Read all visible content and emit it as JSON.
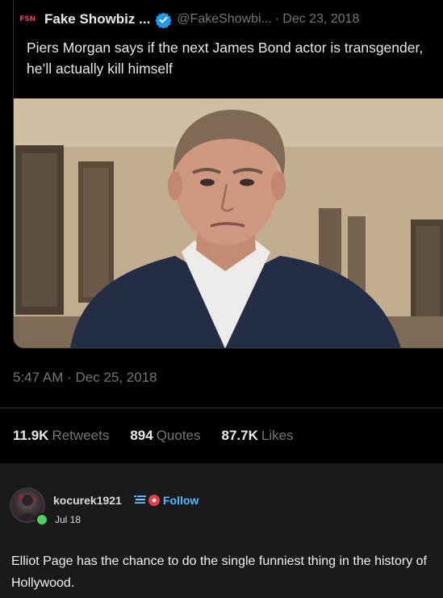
{
  "quoted_tweet": {
    "source_logo": "FSN",
    "author_name": "Fake Showbiz ...",
    "verified_icon": "verified-badge-icon",
    "handle": "@FakeShowbi...",
    "separator": "·",
    "date": "Dec 23, 2018",
    "text": "Piers Morgan says if the next James Bond actor is transgender, he’ll actually kill himself"
  },
  "tweet": {
    "timestamp": "5:47 AM · Dec 25, 2018",
    "stats": [
      {
        "value": "11.9K",
        "label": "Retweets"
      },
      {
        "value": "894",
        "label": "Quotes"
      },
      {
        "value": "87.7K",
        "label": "Likes"
      }
    ]
  },
  "comment": {
    "username": "kocurek1921",
    "follow_label": "Follow",
    "date": "Jul 18",
    "text": "Elliot Page has the chance to do the single funniest thing in the history of Hollywood."
  },
  "colors": {
    "background": "#000000",
    "comment_background": "#1a1a1b",
    "muted_text": "#71767b",
    "verified_blue": "#1d9bf0",
    "follow_blue": "#4fbcff",
    "online_green": "#46d160"
  }
}
